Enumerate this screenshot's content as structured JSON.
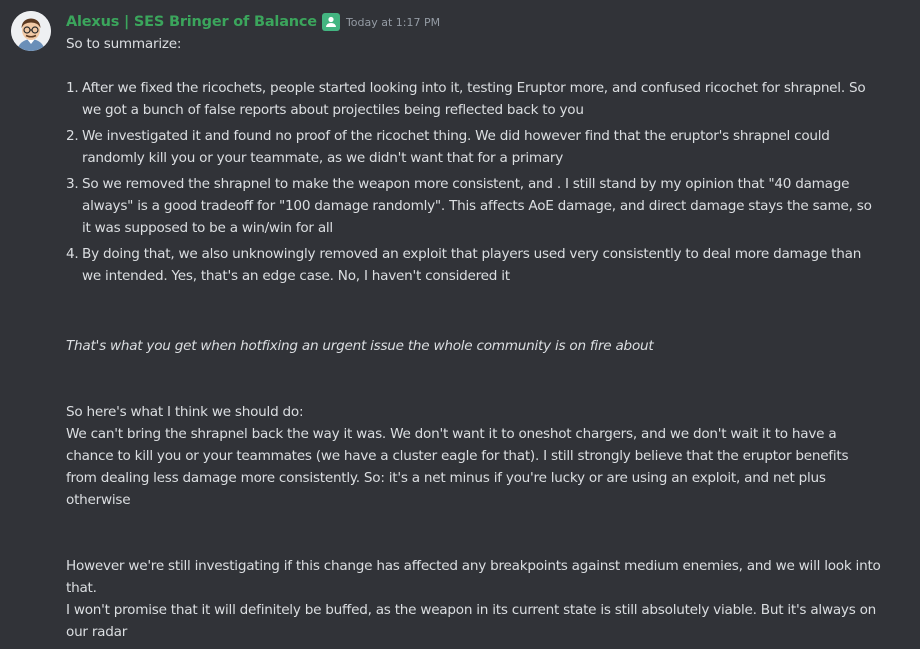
{
  "message": {
    "author": "Alexus | SES Bringer of Balance",
    "timestamp": "Today at 1:17 PM",
    "author_color": "#3ba55c",
    "role_icon": "role-badge-icon",
    "intro": "So to summarize:",
    "points": [
      {
        "number": "1.",
        "text": "After we fixed the ricochets, people started looking into it, testing Eruptor more, and confused ricochet for shrapnel. So we got a bunch of false reports about projectiles being reflected back to you"
      },
      {
        "number": "2.",
        "text": "We investigated it and found no proof of the ricochet thing. We did however find that the eruptor's shrapnel could randomly kill you or your teammate, as we didn't want that for a primary"
      },
      {
        "number": "3.",
        "text": "So we removed the shrapnel to make the weapon more consistent, and . I still stand by my opinion that \"40 damage always\" is a good tradeoff for \"100 damage randomly\". This affects AoE damage, and direct damage stays the same, so it was supposed to be a win/win for all"
      },
      {
        "number": "4.",
        "text": "By doing that, we also unknowingly removed an exploit that players used very consistently to deal more damage than we intended. Yes, that's an edge case. No, I haven't considered it"
      }
    ],
    "italic_line": "That's what you get when hotfixing an urgent issue the whole community is on fire about",
    "plan_heading": "So here's what I think we should do:",
    "plan_body": "We can't bring the shrapnel back the way it was. We don't want it to oneshot chargers, and we don't wait it to have a chance to kill you or your teammates (we have a cluster eagle for that). I still strongly believe that the eruptor benefits from dealing less damage more consistently. So: it's a net minus if you're lucky or are using an exploit, and net plus otherwise",
    "investigating": "However we're still investigating if this change has affected any breakpoints against medium enemies, and we will look into that.",
    "closing": "I won't promise that it will definitely be buffed, as the weapon in its current state is still absolutely viable. But it's always on our radar"
  }
}
